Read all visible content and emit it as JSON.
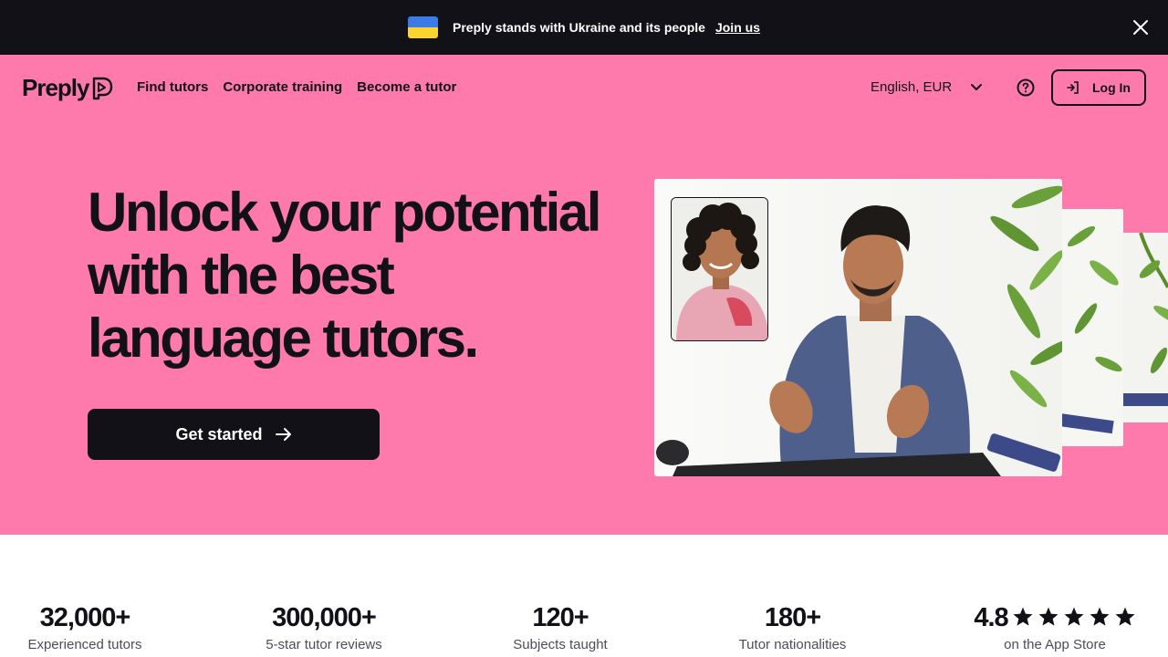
{
  "banner": {
    "message": "Preply stands with Ukraine and its people",
    "link": "Join us",
    "flag_colors": [
      "#3a7be8",
      "#fcd42f"
    ]
  },
  "nav": {
    "logo": "Preply",
    "links": [
      "Find tutors",
      "Corporate training",
      "Become a tutor"
    ],
    "language": "English, EUR",
    "login": "Log In"
  },
  "hero": {
    "headline": [
      "Unlock your potential",
      "with the best",
      "language tutors."
    ],
    "cta": "Get started",
    "background": "#ff7aac"
  },
  "stats": [
    {
      "value": "32,000+",
      "label": "Experienced tutors"
    },
    {
      "value": "300,000+",
      "label": "5-star tutor reviews"
    },
    {
      "value": "120+",
      "label": "Subjects taught"
    },
    {
      "value": "180+",
      "label": "Tutor nationalities"
    },
    {
      "value": "4.8",
      "label": "on the App Store",
      "stars": 5
    }
  ]
}
